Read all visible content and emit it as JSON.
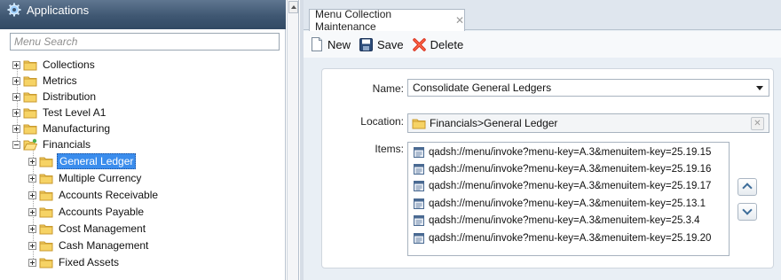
{
  "sidebar": {
    "title": "Applications",
    "search_placeholder": "Menu Search",
    "top_items": [
      "Collections",
      "Metrics",
      "Distribution",
      "Test Level A1",
      "Manufacturing"
    ],
    "financials": {
      "label": "Financials",
      "children": [
        "General Ledger",
        "Multiple Currency",
        "Accounts Receivable",
        "Accounts Payable",
        "Cost Management",
        "Cash Management",
        "Fixed Assets"
      ],
      "selected": "General Ledger"
    }
  },
  "tab": {
    "label": "Menu Collection Maintenance",
    "close": "✕"
  },
  "toolbar": {
    "new_label": "New",
    "save_label": "Save",
    "delete_label": "Delete"
  },
  "form": {
    "name_label": "Name:",
    "name_value": "Consolidate General Ledgers",
    "location_label": "Location:",
    "location_value": "Financials>General Ledger",
    "items_label": "Items:",
    "items": [
      "qadsh://menu/invoke?menu-key=A.3&menuitem-key=25.19.15",
      "qadsh://menu/invoke?menu-key=A.3&menuitem-key=25.19.16",
      "qadsh://menu/invoke?menu-key=A.3&menuitem-key=25.19.17",
      "qadsh://menu/invoke?menu-key=A.3&menuitem-key=25.13.1",
      "qadsh://menu/invoke?menu-key=A.3&menuitem-key=25.3.4",
      "qadsh://menu/invoke?menu-key=A.3&menuitem-key=25.19.20"
    ]
  },
  "colors": {
    "header_bg": "#3f5772",
    "selection": "#3b8ded",
    "panel_bg": "#e9eff5",
    "folder": "#f2c94c"
  }
}
